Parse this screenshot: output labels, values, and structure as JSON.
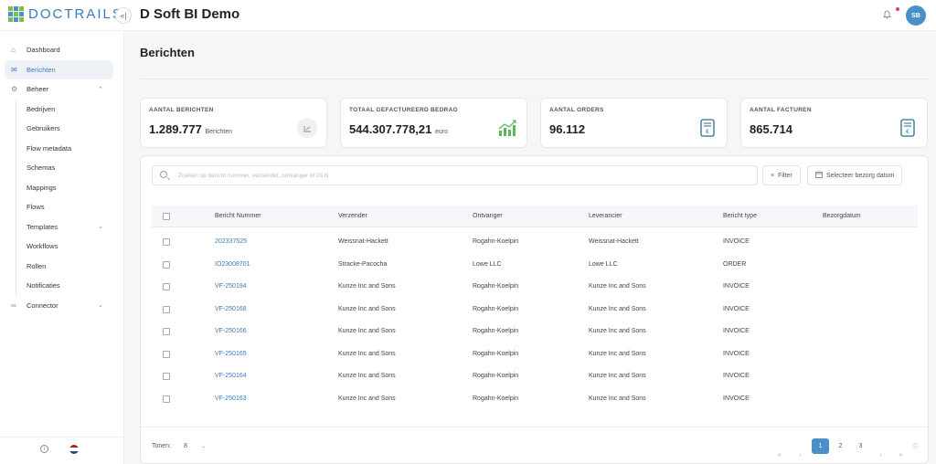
{
  "brand": {
    "logo_text": "DOCTRAILS",
    "logo_colors": [
      "#7ac143",
      "#4a90c8",
      "#7ac143",
      "#4a90c8",
      "#7ac143",
      "#4a90c8",
      "#7ac143",
      "#4a90c8",
      "#7ac143"
    ]
  },
  "header": {
    "collapse_icon": "«|",
    "app_title": "D Soft BI Demo",
    "notifications_icon": "bell-icon",
    "avatar_initials": "SB"
  },
  "sidebar": {
    "items": [
      {
        "label": "Dashboard",
        "icon": "⌂"
      },
      {
        "label": "Berichten",
        "icon": "✉"
      },
      {
        "label": "Beheer",
        "icon": "⚙",
        "chevron": "⌃"
      }
    ],
    "sub_items": [
      {
        "label": "Bedrijven"
      },
      {
        "label": "Gebruikers"
      },
      {
        "label": "Flow metadata"
      },
      {
        "label": "Schemas"
      },
      {
        "label": "Mappings"
      },
      {
        "label": "Flows"
      },
      {
        "label": "Templates",
        "chevron": "⌄"
      },
      {
        "label": "Workflows"
      },
      {
        "label": "Rollen"
      },
      {
        "label": "Notificaties"
      }
    ],
    "connector": {
      "label": "Connector",
      "icon": "∞",
      "chevron": "⌄"
    },
    "footer": {
      "info_icon": "i"
    }
  },
  "page": {
    "title": "Berichten"
  },
  "stats": [
    {
      "label": "AANTAL BERICHTEN",
      "value": "1.289.777",
      "unit": "Berichten"
    },
    {
      "label": "TOTAAL GEFACTUREERD BEDRAG",
      "value": "544.307.778,21",
      "unit": "euro"
    },
    {
      "label": "AANTAL ORDERS",
      "value": "96.112",
      "unit": ""
    },
    {
      "label": "AANTAL FACTUREN",
      "value": "865.714",
      "unit": ""
    }
  ],
  "toolbar": {
    "search_placeholder": "Zoeken op bericht nummer, verzender, ontvanger of GLN",
    "search_value": "",
    "filter_label": "Filter",
    "date_label": "Selecteer bezorg datum"
  },
  "table": {
    "columns": [
      "Bericht Nummer",
      "Verzender",
      "Ontvanger",
      "Leverancier",
      "Bericht type",
      "Bezorgdatum"
    ],
    "rows": [
      [
        "202337525",
        "Weissnat-Hackett",
        "Rogahn-Koelpin",
        "Weissnat-Hackett",
        "INVOICE",
        ""
      ],
      [
        "IO23008701",
        "Stracke-Pacocha",
        "Lowe LLC",
        "Lowe LLC",
        "ORDER",
        ""
      ],
      [
        "VF-250194",
        "Kunze Inc and Sons",
        "Rogahn-Koelpin",
        "Kunze Inc and Sons",
        "INVOICE",
        ""
      ],
      [
        "VF-250168",
        "Kunze Inc and Sons",
        "Rogahn-Koelpin",
        "Kunze Inc and Sons",
        "INVOICE",
        ""
      ],
      [
        "VF-250166",
        "Kunze Inc and Sons",
        "Rogahn-Koelpin",
        "Kunze Inc and Sons",
        "INVOICE",
        ""
      ],
      [
        "VF-250165",
        "Kunze Inc and Sons",
        "Rogahn-Koelpin",
        "Kunze Inc and Sons",
        "INVOICE",
        ""
      ],
      [
        "VF-250164",
        "Kunze Inc and Sons",
        "Rogahn-Koelpin",
        "Kunze Inc and Sons",
        "INVOICE",
        ""
      ],
      [
        "VF-250163",
        "Kunze Inc and Sons",
        "Rogahn-Koelpin",
        "Kunze Inc and Sons",
        "INVOICE",
        ""
      ]
    ]
  },
  "pagination": {
    "show_label": "Tonen:",
    "page_size": "8",
    "pages": [
      "1",
      "2",
      "3"
    ],
    "current_page": "1",
    "first": "«",
    "prev": "‹",
    "next": "›",
    "last": "»"
  },
  "colors": {
    "accent": "#4a90c8",
    "link": "#3a7bbf",
    "notification_dot": "#e6397a",
    "chart_icon": "#5cb85c"
  }
}
